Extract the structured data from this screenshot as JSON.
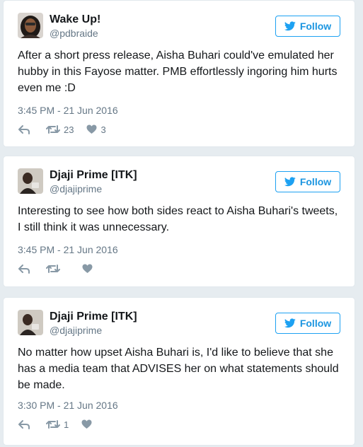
{
  "follow_label": "Follow",
  "icons": [
    "twitter-bird-icon",
    "reply-icon",
    "retweet-icon",
    "heart-icon"
  ],
  "colors": {
    "accent": "#1da1f2",
    "secondary_text": "#657786",
    "background": "#e6ecf0"
  },
  "tweets": [
    {
      "name": "Wake Up!",
      "handle": "@pdbraide",
      "text": "After a short press release, Aisha Buhari could've emulated her hubby in this Fayose matter. PMB effortlessly ingoring him hurts even me :D",
      "time": "3:45 PM - 21 Jun 2016",
      "retweets": "23",
      "likes": "3"
    },
    {
      "name": "Djaji Prime [ITK]",
      "handle": "@djajiprime",
      "text": "Interesting to see how both sides react to Aisha Buhari's tweets, I still think it was unnecessary.",
      "time": "3:45 PM - 21 Jun 2016",
      "retweets": "",
      "likes": ""
    },
    {
      "name": "Djaji Prime [ITK]",
      "handle": "@djajiprime",
      "text": "No matter how upset Aisha Buhari is, I'd like to believe that she has a media team that ADVISES her on what statements should be made.",
      "time": "3:30 PM - 21 Jun 2016",
      "retweets": "1",
      "likes": ""
    }
  ]
}
